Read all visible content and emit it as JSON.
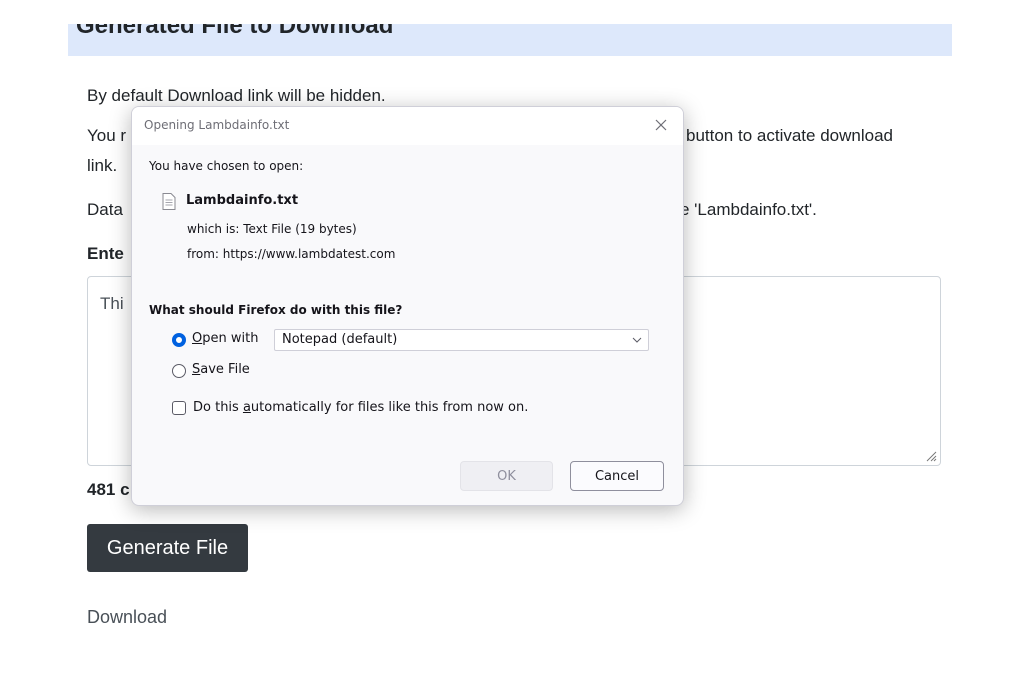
{
  "page": {
    "header_title": "Generated File to Download",
    "p1": "By default Download link will be hidden.",
    "p2_start": "You r",
    "p2_end": "button to activate download",
    "p2_line2": "link.",
    "p3_start": "Data",
    "p3_end": "e 'Lambdainfo.txt'.",
    "label_start": "Ente",
    "textarea_value": "Thi",
    "char_count": "481 c",
    "generate_button": "Generate File",
    "download_link": "Download"
  },
  "dialog": {
    "title": "Opening Lambdainfo.txt",
    "chosen_to_open": "You have chosen to open:",
    "file_name": "Lambdainfo.txt",
    "which_is": "which is:  Text File (19 bytes)",
    "from": "from:  https://www.lambdatest.com",
    "question": "What should Firefox do with this file?",
    "open_with_prefix": "O",
    "open_with_rest": "pen with",
    "app_selected": "Notepad (default)",
    "save_file_prefix": "S",
    "save_file_rest": "ave File",
    "auto_text_1": "Do this ",
    "auto_text_u": "a",
    "auto_text_2": "utomatically for files like this from now on.",
    "ok_label": "OK",
    "cancel_label": "Cancel",
    "open_with_checked": true,
    "save_file_checked": false,
    "auto_checked": false
  },
  "colors": {
    "header_band": "#dde8fb",
    "primary_button": "#343a40",
    "radio_accent": "#0061e0"
  },
  "icons": [
    "close-icon",
    "file-icon",
    "chevron-down-icon",
    "resize-grip-icon"
  ]
}
